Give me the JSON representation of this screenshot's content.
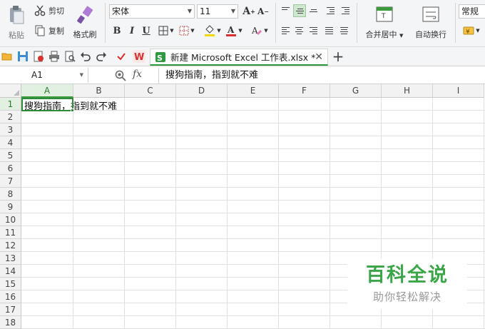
{
  "ribbon": {
    "paste_label": "粘贴",
    "cut_label": "剪切",
    "copy_label": "复制",
    "format_painter_label": "格式刷",
    "font_name": "宋体",
    "font_size": "11",
    "bold": "B",
    "italic": "I",
    "underline": "U",
    "merge_center_label": "合并居中",
    "wrap_text_label": "自动换行",
    "number_format": "常规"
  },
  "document": {
    "tab_title": "新建 Microsoft Excel 工作表.xlsx *"
  },
  "formula_bar": {
    "cell_ref": "A1",
    "fx": "fx",
    "content": "搜狗指南，指到就不难"
  },
  "sheet": {
    "columns": [
      "A",
      "B",
      "C",
      "D",
      "E",
      "F",
      "G",
      "H",
      "I"
    ],
    "rows": [
      "1",
      "2",
      "3",
      "4",
      "5",
      "6",
      "7",
      "8",
      "9",
      "10",
      "11",
      "12",
      "13",
      "14",
      "15",
      "16",
      "17",
      "18"
    ],
    "a1_value": "搜狗指南，指到就不难"
  },
  "watermark": {
    "title": "百科全说",
    "subtitle": "助你轻松解决"
  },
  "colors": {
    "accent_green": "#2f8a3a",
    "wps_red": "#d9302f"
  }
}
